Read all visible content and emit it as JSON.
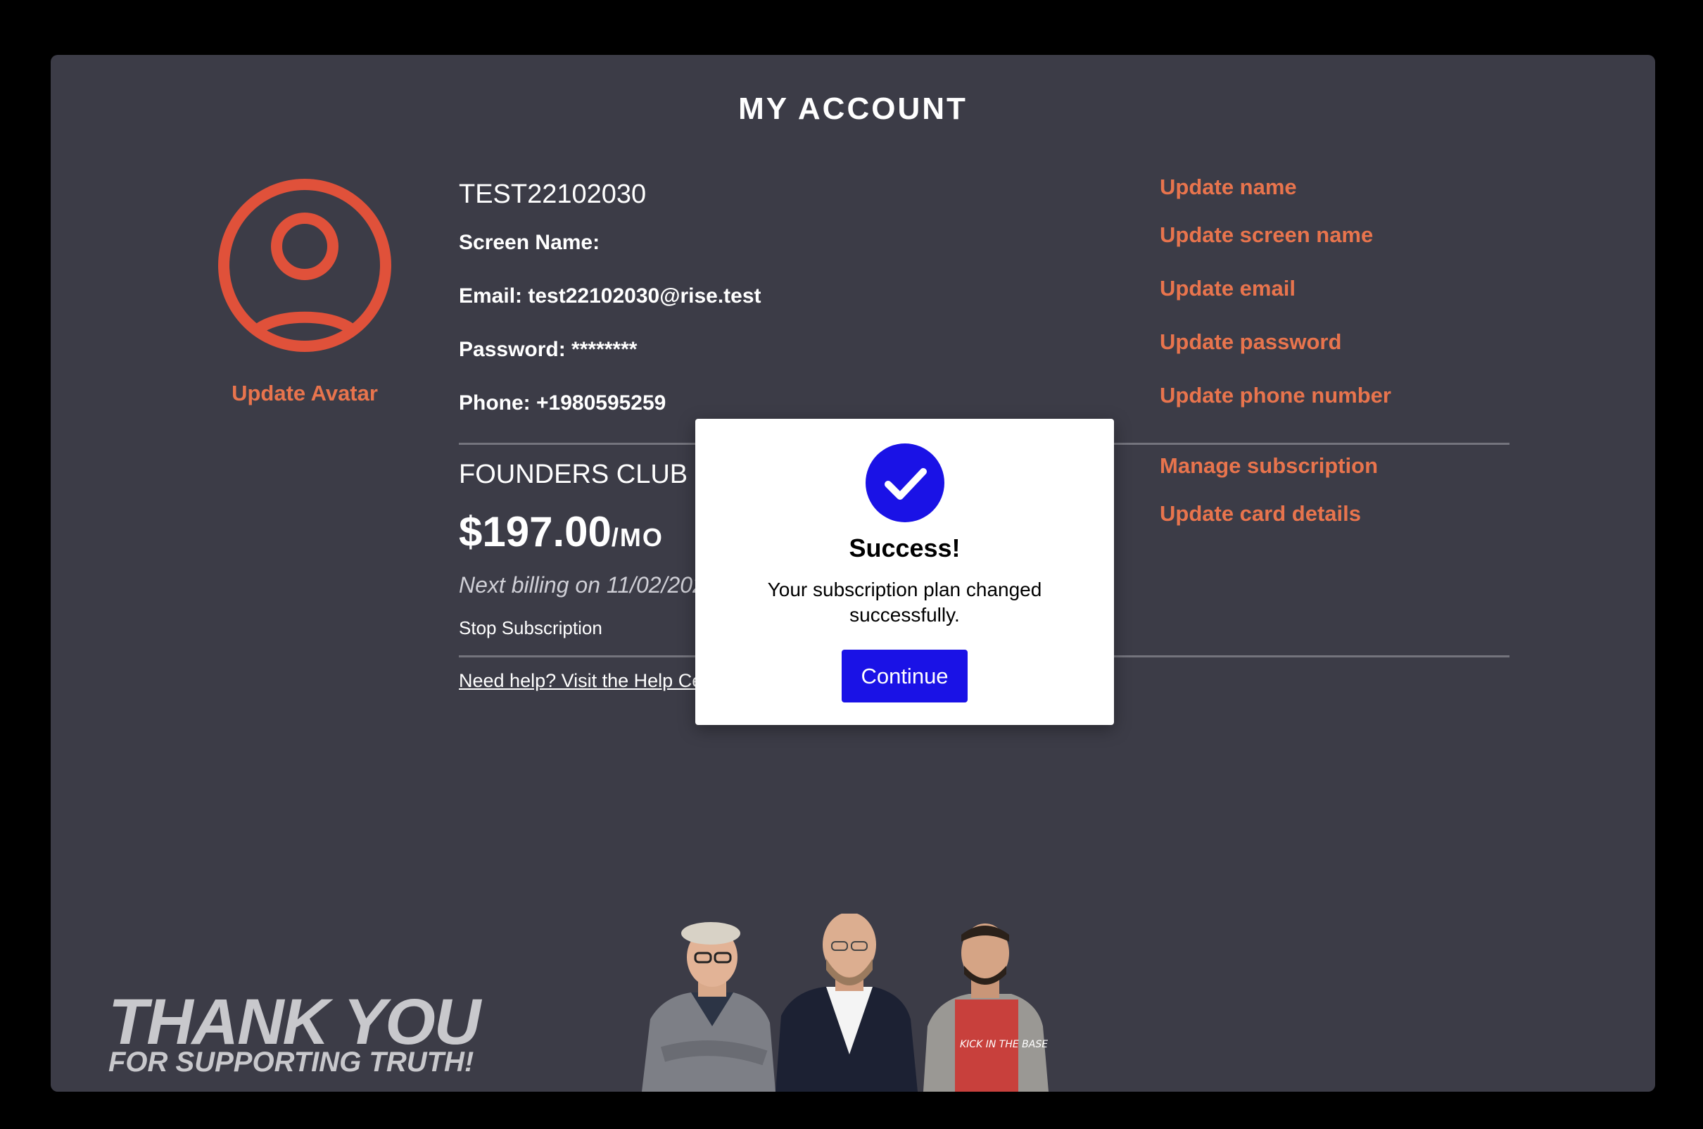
{
  "page": {
    "title": "MY ACCOUNT"
  },
  "avatar": {
    "update_label": "Update Avatar"
  },
  "account": {
    "username": "TEST22102030",
    "screen_name": "Screen Name:",
    "email": "Email: test22102030@rise.test",
    "password": "Password: ********",
    "phone": "Phone: +1980595259"
  },
  "subscription": {
    "plan_name": "FOUNDERS CLUB",
    "price": "$197.00",
    "period": "/MO",
    "next_billing": "Next billing on 11/02/2022",
    "stop_label": "Stop Subscription"
  },
  "help": {
    "link_label": "Need help? Visit the Help Center"
  },
  "actions": {
    "update_name": "Update name",
    "update_screen_name": "Update screen name",
    "update_email": "Update email",
    "update_password": "Update password",
    "update_phone": "Update phone number",
    "manage_subscription": "Manage subscription",
    "update_card": "Update card details"
  },
  "banner": {
    "line1": "THANK YOU",
    "line2": "FOR SUPPORTING TRUTH!",
    "shirt_text": "KICK IN THE BASE"
  },
  "modal": {
    "title": "Success!",
    "message": "Your subscription plan changed successfully.",
    "button_label": "Continue"
  },
  "colors": {
    "background": "#3c3c47",
    "accent": "#e8744d",
    "primary_button": "#1a12e6",
    "avatar_stroke": "#e0513a"
  }
}
